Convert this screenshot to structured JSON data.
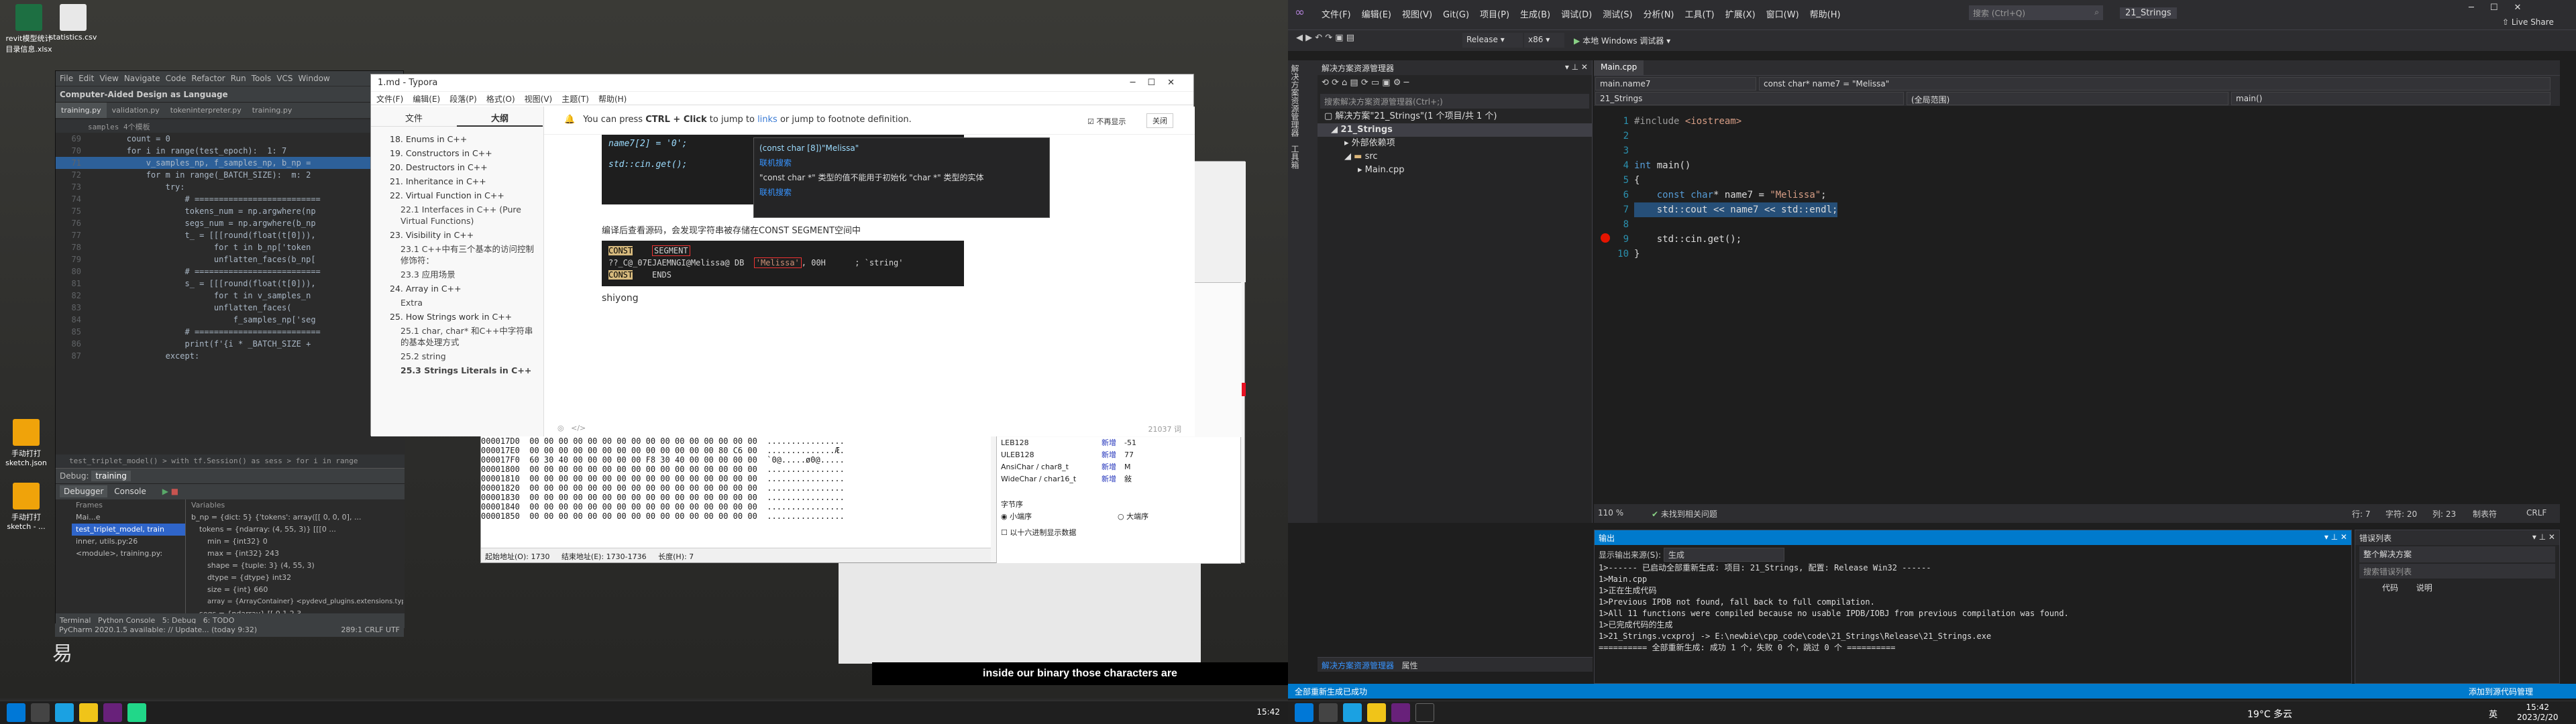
{
  "desktop": {
    "icons": [
      {
        "label": "revit模型统计目录信息.xlsx"
      },
      {
        "label": "statistics.csv"
      },
      {
        "label": "手动打打sketch.json"
      },
      {
        "label": "手动打打sketch - ..."
      }
    ]
  },
  "pycharm": {
    "menu": [
      "File",
      "Edit",
      "View",
      "Navigate",
      "Code",
      "Refactor",
      "Run",
      "Tools",
      "VCS",
      "Window"
    ],
    "nav": "Computer-Aided Design as Language",
    "tabs": [
      "training.py",
      "validation.py",
      "tokeninterpreter.py",
      "training.py"
    ],
    "breadcrumb": "samples 4个模板",
    "code": [
      {
        "n": "69",
        "t": "        count = 0"
      },
      {
        "n": "70",
        "t": "        for i in range(test_epoch):  1: 7"
      },
      {
        "n": "71",
        "t": "            v_samples_np, f_samples_np, b_np = "
      },
      {
        "n": "72",
        "t": "            for m in range(_BATCH_SIZE):  m: 2"
      },
      {
        "n": "73",
        "t": "                try:"
      },
      {
        "n": "74",
        "t": "                    # =========================="
      },
      {
        "n": "75",
        "t": "                    tokens_num = np.argwhere(np"
      },
      {
        "n": "76",
        "t": "                    segs_num = np.argwhere(b_np"
      },
      {
        "n": "77",
        "t": "                    t_ = [[[round(float(t[0])),"
      },
      {
        "n": "78",
        "t": "                          for t in b_np['token"
      },
      {
        "n": "79",
        "t": "                          unflatten_faces(b_np["
      },
      {
        "n": "80",
        "t": "                    # =========================="
      },
      {
        "n": "81",
        "t": "                    s_ = [[[round(float(t[0])),"
      },
      {
        "n": "82",
        "t": "                          for t in v_samples_n"
      },
      {
        "n": "83",
        "t": "                          unflatten_faces("
      },
      {
        "n": "84",
        "t": "                              f_samples_np['seg"
      },
      {
        "n": "85",
        "t": "                    # =========================="
      },
      {
        "n": "86",
        "t": "                    print(f'{i * _BATCH_SIZE + "
      },
      {
        "n": "87",
        "t": "                except:"
      }
    ],
    "crumb2": "test_triplet_model() > with tf.Session() as sess > for i in range",
    "debug": {
      "tab": "Debug:",
      "run": "training",
      "sub_tabs": [
        "Debugger",
        "Console"
      ],
      "frames_label": "Frames",
      "variables_label": "Variables",
      "frames": [
        "Mai...e",
        "test_triplet_model, train",
        "inner, utils.py:26",
        "<module>, training.py:"
      ],
      "vars": [
        "b_np = {dict: 5} {'tokens': array([[ 0, 0, 0], ...",
        "tokens = {ndarray: (4, 55, 3)} [[[0 ...",
        "min = {int32} 0",
        "max = {int32} 243",
        "shape = {tuple: 3} (4, 55, 3)",
        "dtype = {dtype} int32",
        "size = {int} 660",
        "array = {ArrayContainer} <pydevd_plugins.extensions.types.pydevd_plugin_numpy_types.NdArrayItemsContainer object at 0x0000024775...",
        "segs = {ndarray} [[ 0 1 2 3 ..."
      ]
    },
    "bottom_tabs": [
      "6: TODO",
      "Terminal",
      "Python Console",
      "5: Debug",
      "6: TODO"
    ],
    "status": "PyCharm 2020.1.5 available: // Update... (today 9:32)",
    "status_right": "289:1  CRLF  UTF"
  },
  "typora": {
    "title": "1.md - Typora",
    "menu": [
      "文件(F)",
      "编辑(E)",
      "段落(P)",
      "格式(O)",
      "视图(V)",
      "主题(T)",
      "帮助(H)"
    ],
    "side_tabs": [
      "文件",
      "大纲"
    ],
    "toc": [
      {
        "t": "18. Enums in C++",
        "s": false,
        "b": false
      },
      {
        "t": "19. Constructors in C++",
        "s": false,
        "b": false
      },
      {
        "t": "20. Destructors in C++",
        "s": false,
        "b": false
      },
      {
        "t": "21. Inheritance in C++",
        "s": false,
        "b": false
      },
      {
        "t": "22. Virtual Function in C++",
        "s": false,
        "b": false
      },
      {
        "t": "22.1 Interfaces in C++ (Pure Virtual Functions)",
        "s": true,
        "b": false
      },
      {
        "t": "23. Visibility in C++",
        "s": false,
        "b": false
      },
      {
        "t": "23.1 C++中有三个基本的访问控制修饰符：",
        "s": true,
        "b": false
      },
      {
        "t": "23.3 应用场景",
        "s": true,
        "b": false
      },
      {
        "t": "24. Array in C++",
        "s": false,
        "b": false
      },
      {
        "t": "Extra",
        "s": true,
        "b": false
      },
      {
        "t": "25. How Strings work in C++",
        "s": false,
        "b": false
      },
      {
        "t": "25.1 char, char* 和C++中字符串的基本处理方式",
        "s": true,
        "b": false
      },
      {
        "t": "25.2 string",
        "s": true,
        "b": false
      },
      {
        "t": "25.3 Strings Literals in C++",
        "s": true,
        "b": true
      }
    ],
    "notify": {
      "pre": "You can press ",
      "key": "CTRL + Click",
      "mid": " to jump to ",
      "link": "links",
      "post": " or jump to footnote definition.",
      "dont": "不再显示",
      "close": "关闭"
    },
    "code1": [
      "name7[2] = '0';",
      "",
      "std::cin.get();"
    ],
    "tooltip": [
      "(const char [8])\"Melissa\"",
      "联机搜索",
      "\"const char *\" 类型的值不能用于初始化 \"char *\" 类型的实体",
      "联机搜索"
    ],
    "para": "编译后查看源码，会发现字符串被存储在CONST SEGMENT空间中",
    "asm": [
      "CONST    SEGMENT",
      "??_C@_07EJAEMNGI@Melissa@ DB  'Melissa', 00H      ; `string'",
      "CONST    ENDS"
    ],
    "word": "shiyong",
    "wordcount": "21037 词"
  },
  "hex": {
    "rows": [
      "000017D0  00 00 00 00 00 00 00 00 00 00 00 00 00 00 00 00  ................",
      "000017E0  00 00 00 00 00 00 00 00 00 00 00 00 00 80 C6 00  ..............Æ.",
      "000017F0  60 30 40 00 00 00 00 00 F8 30 40 00 00 00 00 00  `0@.....ø0@.....",
      "00001800  00 00 00 00 00 00 00 00 00 00 00 00 00 00 00 00  ................",
      "00001810  00 00 00 00 00 00 00 00 00 00 00 00 00 00 00 00  ................",
      "00001820  00 00 00 00 00 00 00 00 00 00 00 00 00 00 00 00  ................",
      "00001830  00 00 00 00 00 00 00 00 00 00 00 00 00 00 00 00  ................",
      "00001840  00 00 00 00 00 00 00 00 00 00 00 00 00 00 00 00  ................",
      "00001850  00 00 00 00 00 00 00 00 00 00 00 00 00 00 00 00  ................"
    ],
    "status": [
      "起始地址(O): 1730",
      "结束地址(E): 1730-1736",
      "长度(H): 7"
    ],
    "inspector": [
      {
        "k": "LEB128",
        "t": "新增",
        "v": "-51"
      },
      {
        "k": "ULEB128",
        "t": "新增",
        "v": "77"
      },
      {
        "k": "AnsiChar / char8_t",
        "t": "新增",
        "v": "M"
      },
      {
        "k": "WideChar / char16_t",
        "t": "新增",
        "v": "敍"
      }
    ],
    "byte_order": "字节序",
    "little": "小端序",
    "big": "大端序",
    "hexnum": "以十六进制显示数据"
  },
  "subtitle": "inside our binary those characters are",
  "taskbar_left": {
    "time": "15:42"
  },
  "vs": {
    "menu": [
      "文件(F)",
      "编辑(E)",
      "视图(V)",
      "Git(G)",
      "项目(P)",
      "生成(B)",
      "调试(D)",
      "测试(S)",
      "分析(N)",
      "工具(T)",
      "扩展(X)",
      "窗口(W)",
      "帮助(H)"
    ],
    "search": "搜索 (Ctrl+Q)",
    "solution_title": "21_Strings",
    "live_share": "Live Share",
    "config": "Release",
    "platform": "x86",
    "run": "本地 Windows 调试器",
    "sol_panel": "解决方案资源管理器",
    "sol_search": "搜索解决方案资源管理器(Ctrl+;)",
    "sol_tree": [
      "解决方案\"21_Strings\"(1 个项目/共 1 个)",
      "21_Strings",
      "外部依赖项",
      "src",
      "Main.cpp"
    ],
    "side_tabs": [
      "解决方案资源管理器",
      "工具箱"
    ],
    "edtab": "Main.cpp",
    "nav1": "main.name7",
    "nav2": "const char* name7 = \"Melissa\"",
    "nav3": "21_Strings",
    "nav4": "(全局范围)",
    "nav5": "main()",
    "code": [
      {
        "n": "1",
        "h": "<span class='vpp'>#include</span> <span class='vst'>&lt;iostream&gt;</span>"
      },
      {
        "n": "2",
        "h": ""
      },
      {
        "n": "3",
        "h": ""
      },
      {
        "n": "4",
        "h": "<span class='vkw'>int</span> main()"
      },
      {
        "n": "5",
        "h": "{"
      },
      {
        "n": "6",
        "h": "    <span class='vkw'>const char</span>* name7 = <span class='vst'>\"Melissa\"</span>;"
      },
      {
        "n": "7",
        "h": "    std::cout &lt;&lt; name7 &lt;&lt; std::endl;"
      },
      {
        "n": "8",
        "h": ""
      },
      {
        "n": "9",
        "h": "    std::cin.get();"
      },
      {
        "n": "10",
        "h": "}"
      }
    ],
    "zoom": "110 %",
    "issues": "未找到相关问题",
    "pos": [
      "行: 7",
      "字符: 20",
      "列: 23",
      "制表符",
      "CRLF"
    ],
    "out_title": "输出",
    "out_src_label": "显示输出来源(S):",
    "out_src": "生成",
    "output": [
      "1>------ 已启动全部重新生成: 项目: 21_Strings, 配置: Release Win32 ------",
      "1>Main.cpp",
      "1>正在生成代码",
      "1>Previous IPDB not found, fall back to full compilation.",
      "1>All 11 functions were compiled because no usable IPDB/IOBJ from previous compilation was found.",
      "1>已完成代码的生成",
      "1>21_Strings.vcxproj -> E:\\newbie\\cpp_code\\code\\21_Strings\\Release\\21_Strings.exe",
      "========== 全部重新生成: 成功 1 个，失败 0 个，跳过 0 个 =========="
    ],
    "err_title": "错误列表",
    "err_scope": "整个解决方案",
    "err_search": "搜索错误列表",
    "err_cols": [
      "代码",
      "说明"
    ],
    "bottom_tabs": [
      "解决方案资源管理器",
      "属性"
    ],
    "status": "全部重新生成已成功",
    "status_right": "添加到源代码管理",
    "time": "15:42",
    "date": "2023/2/20",
    "weather": "19°C 多云",
    "ime": "英"
  }
}
